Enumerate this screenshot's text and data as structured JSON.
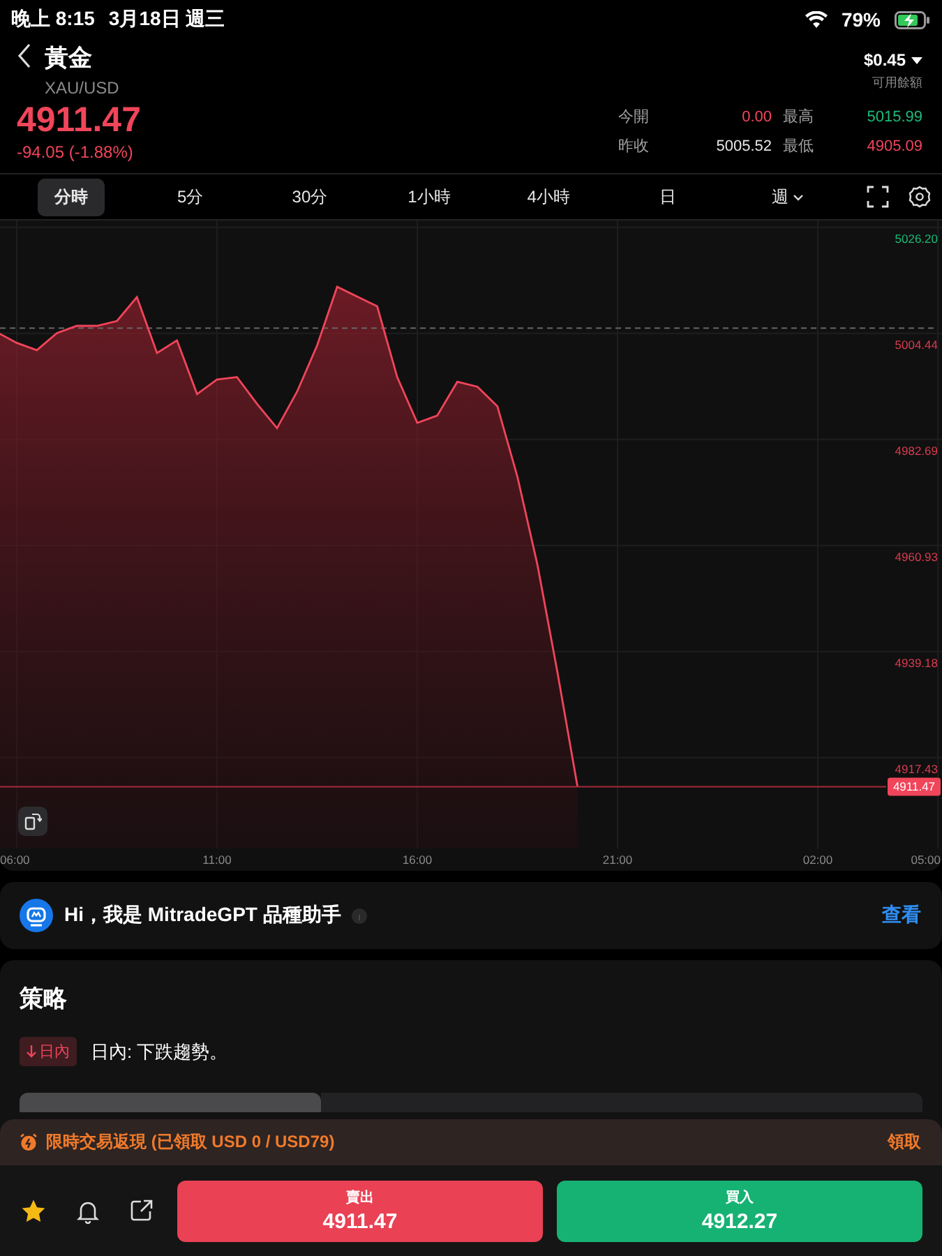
{
  "status_bar": {
    "time": "晚上 8:15",
    "date": "3月18日 週三",
    "battery": "79%"
  },
  "header": {
    "title": "黃金",
    "symbol": "XAU/USD",
    "balance": "$0.45",
    "balance_label": "可用餘額"
  },
  "quote": {
    "price": "4911.47",
    "change": "-94.05 (-1.88%)",
    "color": "#f0455a",
    "stats": [
      {
        "label": "今開",
        "value": "0.00",
        "color": "#f0455a"
      },
      {
        "label": "最高",
        "value": "5015.99",
        "color": "#1dbb7a"
      },
      {
        "label": "昨收",
        "value": "5005.52",
        "color": "#e6e6e6"
      },
      {
        "label": "最低",
        "value": "4905.09",
        "color": "#f0455a"
      }
    ]
  },
  "period_tabs": [
    {
      "label": "分時",
      "selected": true
    },
    {
      "label": "5分",
      "selected": false
    },
    {
      "label": "30分",
      "selected": false
    },
    {
      "label": "1小時",
      "selected": false
    },
    {
      "label": "4小時",
      "selected": false
    },
    {
      "label": "日",
      "selected": false
    },
    {
      "label": "週",
      "selected": false,
      "dropdown": true
    }
  ],
  "chart": {
    "chart_data": {
      "type": "area",
      "grid": true,
      "ylim": [
        4898.8,
        5027.6
      ],
      "categories": [
        null,
        "06:00",
        null,
        null,
        null,
        null,
        null,
        null,
        null,
        null,
        null,
        "11:00",
        null,
        null,
        null,
        null,
        null,
        null,
        null,
        null,
        null,
        "16:00",
        null,
        null,
        null,
        null,
        null,
        null,
        null,
        null,
        null,
        "21:00",
        null,
        null,
        null,
        null,
        null,
        null,
        null,
        null,
        null,
        "02:00",
        null,
        null,
        null,
        null,
        null,
        "05:00"
      ],
      "yticks": [
        {
          "value": 5026.2,
          "label": "5026.20"
        },
        {
          "value": 5004.44,
          "label": "5004.44"
        },
        {
          "value": 4982.69,
          "label": "4982.69"
        },
        {
          "value": 4960.93,
          "label": "4960.93"
        },
        {
          "value": 4939.18,
          "label": "4939.18"
        },
        {
          "value": 4917.43,
          "label": "4917.43"
        }
      ],
      "series": [
        {
          "color": "#f0455a",
          "values": [
            5004.7,
            5002.5,
            5001.0,
            5004.5,
            5006.0,
            5006.0,
            5007.0,
            5011.9,
            5000.4,
            5003.0,
            4992.0,
            4995.0,
            4995.5,
            4990.0,
            4985.0,
            4992.5,
            5002.0,
            5014.0,
            5012.0,
            5010.0,
            4995.5,
            4986.1,
            4987.6,
            4994.5,
            4993.5,
            4989.5,
            4975.0,
            4957.0,
            4935.0,
            4911.5,
            null,
            null,
            null,
            null,
            null,
            null,
            null,
            null,
            null,
            null,
            null,
            null,
            null,
            null,
            null,
            null,
            null,
            null
          ]
        }
      ],
      "ref_lines": [
        {
          "axis": "y",
          "value": 5005.52
        },
        {
          "axis": "y",
          "value": 4911.47,
          "label": "4911.47"
        }
      ]
    }
  },
  "assistant": {
    "text": "Hi，我是 MitradeGPT 品種助手",
    "link": "查看"
  },
  "strategy": {
    "title": "策略",
    "tag": {
      "label": "日內",
      "color": "#f0455a"
    },
    "summary": "日內: 下跌趨勢。",
    "periods": [
      {
        "selected": true
      },
      {
        "selected": false
      },
      {
        "selected": false
      }
    ]
  },
  "promo": {
    "text": "限時交易返現 (已領取 USD 0 / USD79)",
    "action": "領取"
  },
  "trade_bar": {
    "favorite": true,
    "sell": {
      "label": "賣出",
      "price": "4911.47"
    },
    "buy": {
      "label": "買入",
      "price": "4912.27"
    }
  }
}
